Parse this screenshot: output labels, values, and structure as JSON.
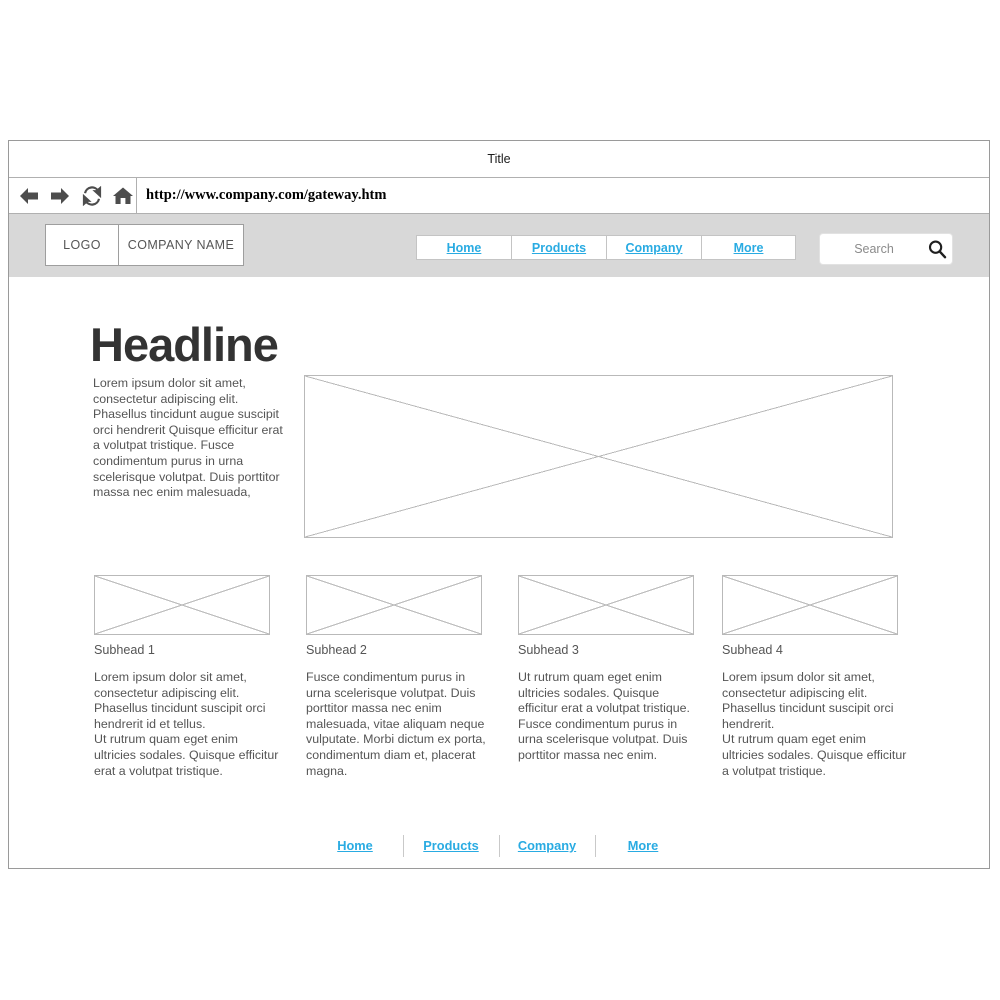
{
  "browser": {
    "title": "Title",
    "url": "http://www.company.com/gateway.htm",
    "nav_icons": [
      {
        "name": "back-icon",
        "glyph": "back"
      },
      {
        "name": "forward-icon",
        "glyph": "forward"
      },
      {
        "name": "refresh-icon",
        "glyph": "refresh"
      },
      {
        "name": "home-icon",
        "glyph": "home"
      }
    ]
  },
  "site_header": {
    "logo_label": "LOGO",
    "company_name": "COMPANY NAME",
    "nav": [
      {
        "label": "Home"
      },
      {
        "label": "Products"
      },
      {
        "label": "Company"
      },
      {
        "label": "More"
      }
    ],
    "search": {
      "placeholder": "Search",
      "icon": "search-icon"
    },
    "background_color": "#d8d8d8",
    "link_color": "#29abe2"
  },
  "main": {
    "headline": "Headline",
    "hero_paragraph": "Lorem ipsum dolor sit amet, consectetur adipiscing elit. Phasellus tincidunt augue suscipit orci hendrerit Quisque efficitur erat a volutpat tristique. Fusce condimentum purus in urna scelerisque volutpat. Duis porttitor massa nec enim malesuada,",
    "hero_image": "image-placeholder",
    "columns": [
      {
        "subhead": "Subhead 1",
        "body": "Lorem ipsum dolor sit amet, consectetur adipiscing elit. Phasellus tincidunt suscipit orci hendrerit id et tellus.\nUt rutrum quam eget enim ultricies sodales. Quisque efficitur erat a volutpat tristique."
      },
      {
        "subhead": "Subhead 2",
        "body": " Fusce condimentum purus in urna scelerisque volutpat. Duis porttitor massa nec enim malesuada, vitae aliquam neque vulputate. Morbi dictum ex porta, condimentum diam et, placerat magna."
      },
      {
        "subhead": "Subhead 3",
        "body": "Ut rutrum quam eget enim ultricies sodales. Quisque efficitur erat a volutpat tristique. Fusce condimentum purus in urna scelerisque volutpat. Duis porttitor massa nec enim."
      },
      {
        "subhead": "Subhead 4",
        "body": "Lorem ipsum dolor sit amet, consectetur adipiscing elit. Phasellus tincidunt suscipit orci hendrerit.\nUt rutrum quam eget enim ultricies sodales. Quisque efficitur a volutpat tristique."
      }
    ]
  },
  "footer": {
    "nav": [
      {
        "label": "Home"
      },
      {
        "label": "Products"
      },
      {
        "label": "Company"
      },
      {
        "label": "More"
      }
    ],
    "link_color": "#29abe2"
  }
}
